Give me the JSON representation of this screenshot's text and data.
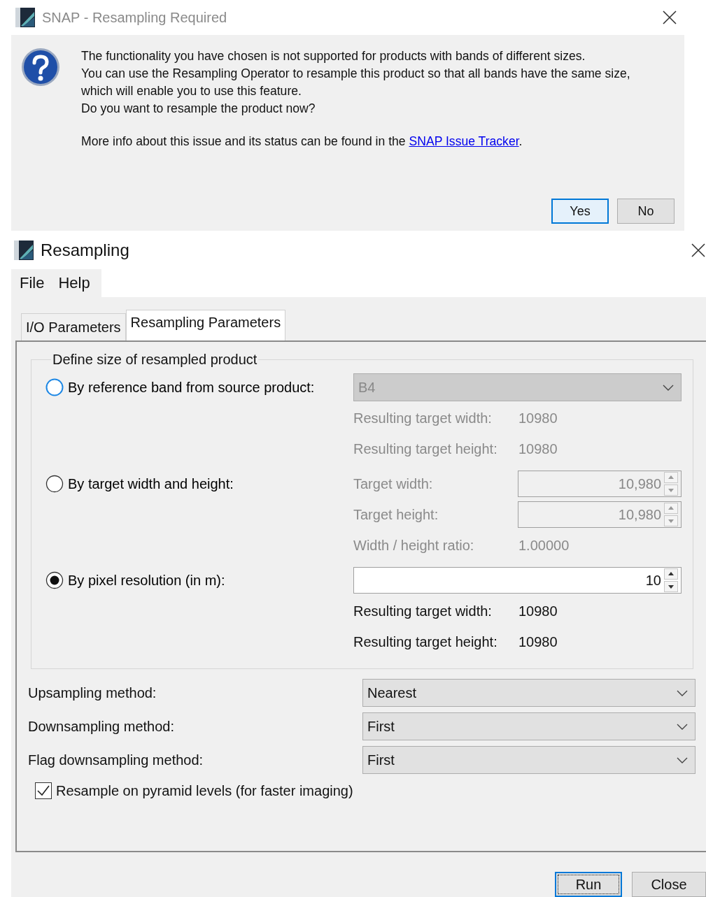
{
  "alert": {
    "title": "SNAP - Resampling Required",
    "message": [
      "The functionality you have chosen is not supported for products with bands of different sizes.",
      "You can use the Resampling Operator to resample this product so that all bands have the same size,",
      "which will enable you to use this feature.",
      "Do you want to resample the product now?"
    ],
    "info_text": "More info about this issue and its status can be found in the ",
    "info_link": "SNAP Issue Tracker",
    "info_end": ".",
    "buttons": [
      {
        "label": "Yes",
        "default": true
      },
      {
        "label": "No",
        "default": false
      }
    ]
  },
  "window": {
    "title": "Resampling",
    "menu": [
      "File",
      "Help"
    ],
    "tabs": [
      {
        "label": "I/O Parameters",
        "selected": false
      },
      {
        "label": "Resampling Parameters",
        "selected": true
      }
    ],
    "group_title": "Define size of resampled product",
    "options": [
      {
        "label": "By reference band from source product:",
        "selected": false,
        "focused": true,
        "controls": [
          {
            "kind": "combo",
            "value": "B4"
          },
          {
            "kind": "readout",
            "label": "Resulting target width:",
            "value": "10980"
          },
          {
            "kind": "readout",
            "label": "Resulting target height:",
            "value": "10980"
          }
        ]
      },
      {
        "label": "By target width and height:",
        "selected": false,
        "focused": false,
        "controls": [
          {
            "kind": "spinner",
            "label": "Target width:",
            "value": "10,980"
          },
          {
            "kind": "spinner",
            "label": "Target height:",
            "value": "10,980"
          },
          {
            "kind": "readout",
            "label": "Width / height ratio:",
            "value": "1.00000"
          }
        ]
      },
      {
        "label": "By pixel resolution (in m):",
        "selected": true,
        "focused": false,
        "controls": [
          {
            "kind": "spinner",
            "value": "10"
          },
          {
            "kind": "readout",
            "label": "Resulting target width:",
            "value": "10980"
          },
          {
            "kind": "readout",
            "label": "Resulting target height:",
            "value": "10980"
          }
        ]
      }
    ],
    "methods": [
      {
        "label": "Upsampling method:",
        "value": "Nearest"
      },
      {
        "label": "Downsampling method:",
        "value": "First"
      },
      {
        "label": "Flag downsampling method:",
        "value": "First"
      }
    ],
    "pyramid": {
      "label": "Resample on pyramid levels (for faster imaging)",
      "checked": true
    },
    "buttons": [
      {
        "label": "Run",
        "focused": true
      },
      {
        "label": "Close",
        "focused": false
      }
    ]
  }
}
